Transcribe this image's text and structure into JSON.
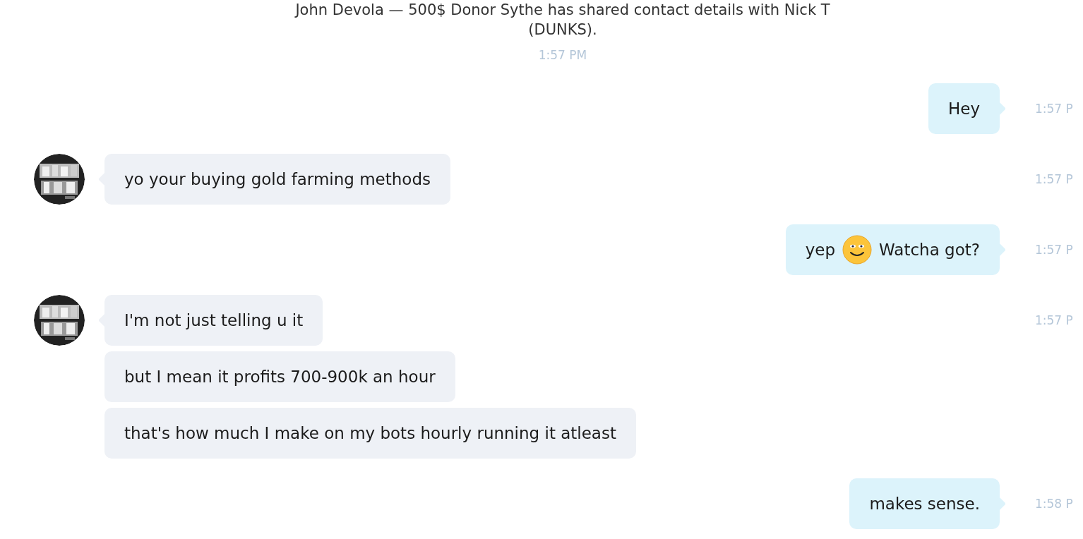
{
  "system_message": {
    "text": "John Devola — 500$ Donor Sythe has shared contact details with Nick T (DUNKS).",
    "time": "1:57 PM"
  },
  "messages": [
    {
      "kind": "outgoing",
      "time": "1:57 P",
      "bubbles": [
        {
          "segments": [
            {
              "kind": "text",
              "text": "Hey"
            }
          ]
        }
      ]
    },
    {
      "kind": "incoming",
      "time": "1:57 P",
      "bubbles": [
        {
          "segments": [
            {
              "kind": "text",
              "text": "yo your buying gold farming methods"
            }
          ]
        }
      ]
    },
    {
      "kind": "outgoing",
      "time": "1:57 P",
      "bubbles": [
        {
          "segments": [
            {
              "kind": "text",
              "text": "yep"
            },
            {
              "kind": "emoji"
            },
            {
              "kind": "text",
              "text": "Watcha got?"
            }
          ]
        }
      ]
    },
    {
      "kind": "incoming",
      "time": "1:57 P",
      "bubbles": [
        {
          "segments": [
            {
              "kind": "text",
              "text": "I'm not just telling u it"
            }
          ]
        },
        {
          "segments": [
            {
              "kind": "text",
              "text": "but I mean it profits 700-900k an hour"
            }
          ]
        },
        {
          "segments": [
            {
              "kind": "text",
              "text": "that's how much I make on my bots hourly running it atleast"
            }
          ]
        }
      ]
    },
    {
      "kind": "outgoing",
      "time": "1:58 P",
      "bubbles": [
        {
          "segments": [
            {
              "kind": "text",
              "text": "makes sense."
            }
          ]
        }
      ]
    }
  ]
}
